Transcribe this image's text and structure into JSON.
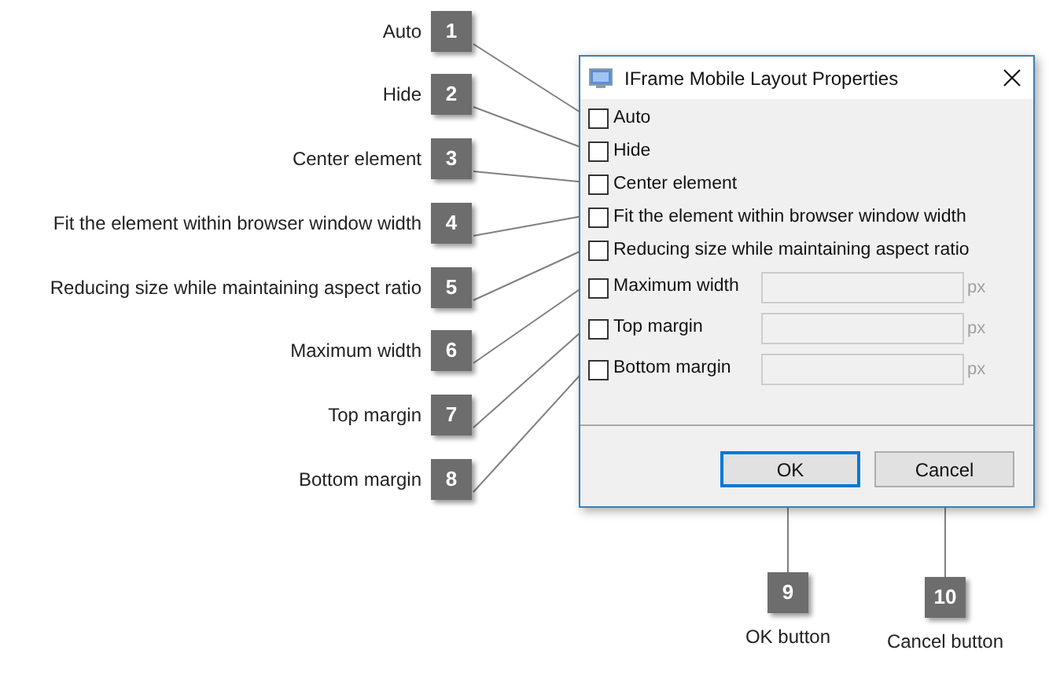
{
  "callouts": [
    {
      "number": "1",
      "label": "Auto"
    },
    {
      "number": "2",
      "label": "Hide"
    },
    {
      "number": "3",
      "label": "Center element"
    },
    {
      "number": "4",
      "label": "Fit the element within browser window width"
    },
    {
      "number": "5",
      "label": "Reducing size while maintaining aspect ratio"
    },
    {
      "number": "6",
      "label": "Maximum width"
    },
    {
      "number": "7",
      "label": "Top margin"
    },
    {
      "number": "8",
      "label": "Bottom margin"
    }
  ],
  "button_callouts": [
    {
      "number": "9",
      "label": "OK button"
    },
    {
      "number": "10",
      "label": "Cancel button"
    }
  ],
  "dialog": {
    "title": "IFrame Mobile Layout Properties",
    "options": [
      {
        "kind": "checkbox",
        "label": "Auto",
        "checked": false
      },
      {
        "kind": "checkbox",
        "label": "Hide",
        "checked": false
      },
      {
        "kind": "checkbox",
        "label": "Center element",
        "checked": false
      },
      {
        "kind": "checkbox",
        "label": "Fit the element within browser window width",
        "checked": false
      },
      {
        "kind": "checkbox",
        "label": "Reducing size while maintaining aspect ratio",
        "checked": false
      },
      {
        "kind": "field",
        "label": "Maximum width",
        "checked": false,
        "disabled": true,
        "unit": "px"
      },
      {
        "kind": "field",
        "label": "Top margin",
        "checked": false,
        "disabled": true,
        "unit": "px"
      },
      {
        "kind": "field",
        "label": "Bottom margin",
        "checked": false,
        "disabled": true,
        "unit": "px"
      }
    ],
    "buttons": [
      {
        "label": "OK",
        "default": true
      },
      {
        "label": "Cancel",
        "default": false
      }
    ]
  }
}
